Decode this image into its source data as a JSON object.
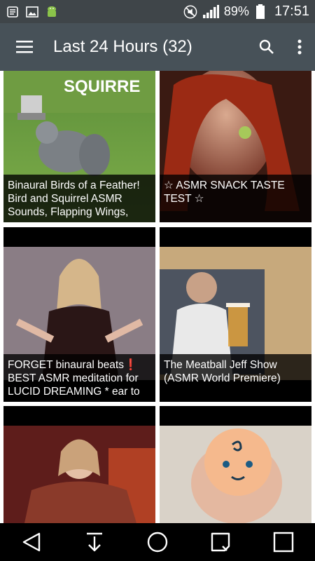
{
  "status": {
    "battery": "89%",
    "time": "17:51",
    "left_icons": [
      "notification-icon",
      "gallery-icon",
      "android-icon"
    ],
    "right_icons": [
      "mute-icon",
      "signal-icon",
      "battery-icon"
    ]
  },
  "toolbar": {
    "title": "Last 24 Hours (32)",
    "menu_icon": "hamburger-icon",
    "search_icon": "search-icon",
    "overflow_icon": "more-vert-icon"
  },
  "videos": [
    {
      "title": "Binaural Birds of a Feather! Bird and Squirrel ASMR Sounds, Flapping Wings,",
      "thumb_text": "SQUIRRE"
    },
    {
      "title": "☆ ASMR SNACK TASTE TEST ☆"
    },
    {
      "title": "FORGET binaural beats❗ BEST ASMR meditation for LUCID DREAMING * ear to"
    },
    {
      "title": "The Meatball Jeff Show (ASMR World Premiere)"
    },
    {
      "title": ""
    },
    {
      "title": ""
    }
  ],
  "nav": [
    "back-icon",
    "download-icon",
    "home-icon",
    "recents-icon",
    "square-icon"
  ]
}
